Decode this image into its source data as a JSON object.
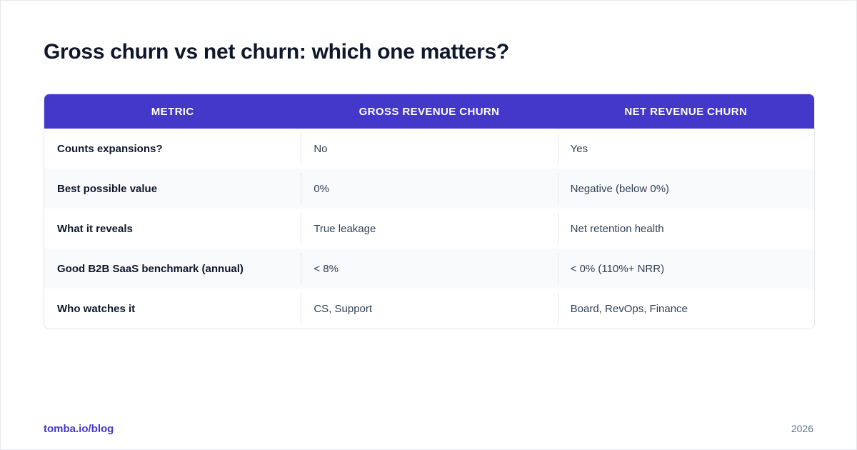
{
  "title": "Gross churn vs net churn: which one matters?",
  "table": {
    "headers": [
      "METRIC",
      "GROSS REVENUE CHURN",
      "NET REVENUE CHURN"
    ],
    "rows": [
      [
        "Counts expansions?",
        "No",
        "Yes"
      ],
      [
        "Best possible value",
        "0%",
        "Negative (below 0%)"
      ],
      [
        "What it reveals",
        "True leakage",
        "Net retention health"
      ],
      [
        "Good B2B SaaS benchmark (annual)",
        "< 8%",
        "< 0% (110%+ NRR)"
      ],
      [
        "Who watches it",
        "CS, Support",
        "Board, RevOps, Finance"
      ]
    ]
  },
  "footer": {
    "link": "tomba.io/blog",
    "year": "2026"
  },
  "colors": {
    "header_bg": "#4338ca",
    "title_text": "#0f172a",
    "row_alt_bg": "#f8fafc",
    "link": "#4338ca"
  }
}
